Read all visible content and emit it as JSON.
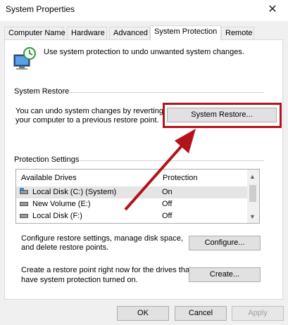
{
  "window": {
    "title": "System Properties"
  },
  "tabs": [
    {
      "label": "Computer Name"
    },
    {
      "label": "Hardware"
    },
    {
      "label": "Advanced"
    },
    {
      "label": "System Protection"
    },
    {
      "label": "Remote"
    }
  ],
  "active_tab": "System Protection",
  "intro": {
    "text": "Use system protection to undo unwanted system changes."
  },
  "system_restore": {
    "group_label": "System Restore",
    "description_line1": "You can undo system changes by reverting",
    "description_line2": "your computer to a previous restore point.",
    "button_label": "System Restore..."
  },
  "protection": {
    "group_label": "Protection Settings",
    "columns": [
      "Available Drives",
      "Protection"
    ],
    "drives": [
      {
        "name": "Local Disk (C:) (System)",
        "protection": "On",
        "selected": true
      },
      {
        "name": "New Volume (E:)",
        "protection": "Off",
        "selected": false
      },
      {
        "name": "Local Disk (F:)",
        "protection": "Off",
        "selected": false
      }
    ],
    "configure_text_line1": "Configure restore settings, manage disk space,",
    "configure_text_line2": "and delete restore points.",
    "configure_button": "Configure...",
    "create_text_line1": "Create a restore point right now for the drives that",
    "create_text_line2": "have system protection turned on.",
    "create_button": "Create..."
  },
  "footer": {
    "ok": "OK",
    "cancel": "Cancel",
    "apply": "Apply"
  },
  "colors": {
    "annotation_red": "#b3131b",
    "selected_row": "#e5e5e5"
  }
}
